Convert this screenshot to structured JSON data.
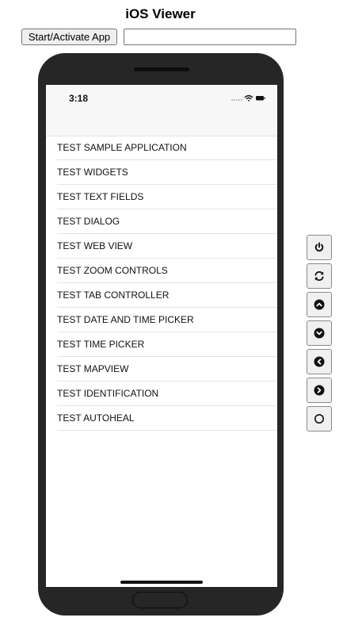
{
  "header": {
    "title": "iOS Viewer",
    "start_button_label": "Start/Activate App",
    "url_input_value": ""
  },
  "device": {
    "status_time": "3:18",
    "list_items": [
      "TEST SAMPLE APPLICATION",
      "TEST WIDGETS",
      "TEST TEXT FIELDS",
      "TEST DIALOG",
      "TEST WEB VIEW",
      "TEST ZOOM CONTROLS",
      "TEST TAB CONTROLLER",
      "TEST DATE AND TIME PICKER",
      "TEST TIME PICKER",
      "TEST MAPVIEW",
      "TEST IDENTIFICATION",
      "TEST AUTOHEAL"
    ]
  },
  "side_controls": [
    {
      "icon": "power-icon"
    },
    {
      "icon": "refresh-icon"
    },
    {
      "icon": "chevron-up-icon"
    },
    {
      "icon": "chevron-down-icon"
    },
    {
      "icon": "chevron-left-icon"
    },
    {
      "icon": "chevron-right-icon"
    },
    {
      "icon": "home-circle-icon"
    }
  ],
  "colors": {
    "phone_body": "#262626",
    "status_bar_bg": "#f7f7f7",
    "row_divider": "#e4e4e4",
    "control_bg": "#f0f0f0"
  }
}
